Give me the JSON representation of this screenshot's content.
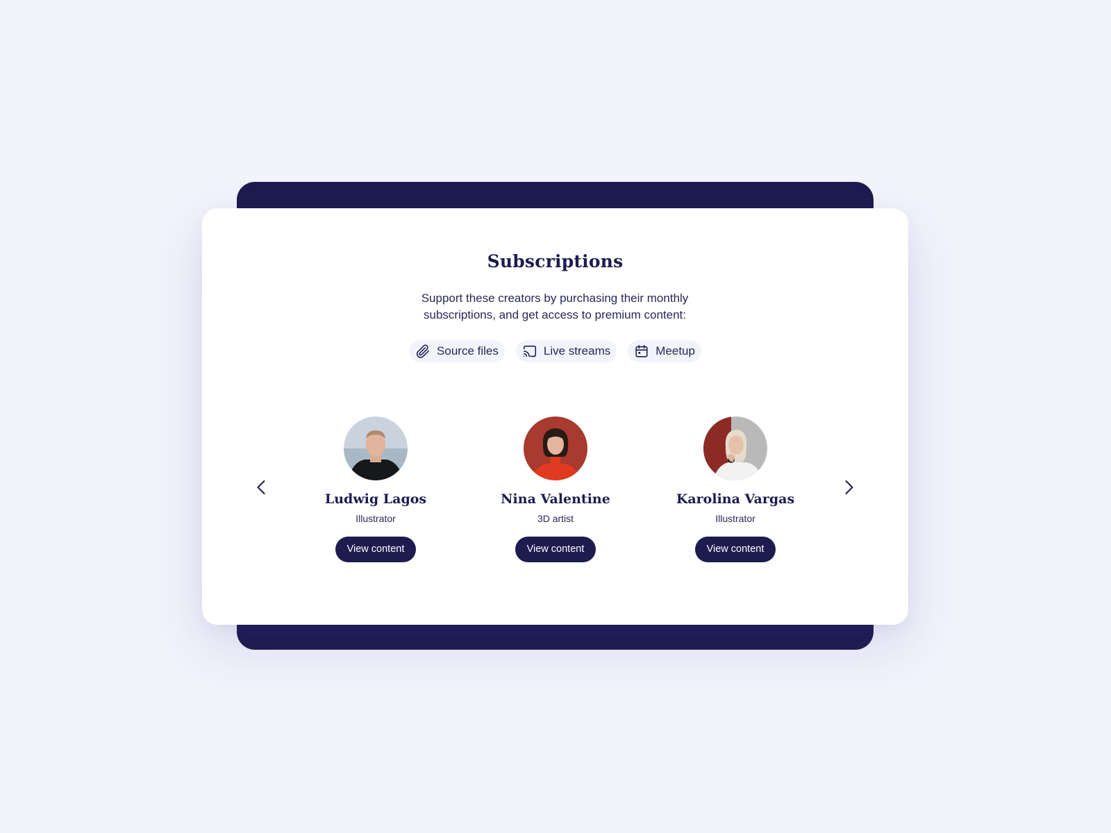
{
  "title": "Subscriptions",
  "subtitle": "Support these creators by purchasing their monthly subscriptions, and get access to premium content:",
  "features": [
    {
      "label": "Source files",
      "icon": "paperclip-icon"
    },
    {
      "label": "Live streams",
      "icon": "cast-icon"
    },
    {
      "label": "Meetup",
      "icon": "calendar-icon"
    }
  ],
  "creators": [
    {
      "name": "Ludwig Lagos",
      "role": "Illustrator",
      "button": "View content"
    },
    {
      "name": "Nina Valentine",
      "role": "3D artist",
      "button": "View content"
    },
    {
      "name": "Karolina Vargas",
      "role": "Illustrator",
      "button": "View content"
    }
  ],
  "nav": {
    "prev_icon": "chevron-left-icon",
    "next_icon": "chevron-right-icon"
  },
  "colors": {
    "brand": "#1e1b4f",
    "background": "#f3f3fc",
    "card": "#ffffff",
    "chip": "#f3f3fb"
  }
}
